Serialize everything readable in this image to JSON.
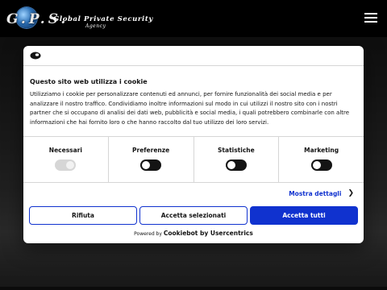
{
  "header": {
    "logo_gps": "G.P.S.",
    "logo_name": "Global Private Security",
    "logo_sub": "Agency"
  },
  "dialog": {
    "title": "Questo sito web utilizza i cookie",
    "body": "Utilizziamo i cookie per personalizzare contenuti ed annunci, per fornire funzionalità dei social media e per analizzare il nostro traffico. Condividiamo inoltre informazioni sul modo in cui utilizzi il nostro sito con i nostri partner che si occupano di analisi dei dati web, pubblicità e social media, i quali potrebbero combinarle con altre informazioni che hai fornito loro o che hanno raccolto dal tuo utilizzo dei loro servizi.",
    "categories": [
      {
        "label": "Necessari",
        "state": "on-locked"
      },
      {
        "label": "Preferenze",
        "state": "off"
      },
      {
        "label": "Statistiche",
        "state": "off"
      },
      {
        "label": "Marketing",
        "state": "off"
      }
    ],
    "details_link": "Mostra dettagli",
    "buttons": {
      "reject": "Rifiuta",
      "accept_selected": "Accetta selezionati",
      "accept_all": "Accetta tutti"
    },
    "powered_prefix": "Powered by",
    "powered_brand": "Cookiebot by Usercentrics"
  },
  "colors": {
    "accent": "#1032cf",
    "toggle_off": "#141414",
    "toggle_locked": "#d6d6d6"
  }
}
